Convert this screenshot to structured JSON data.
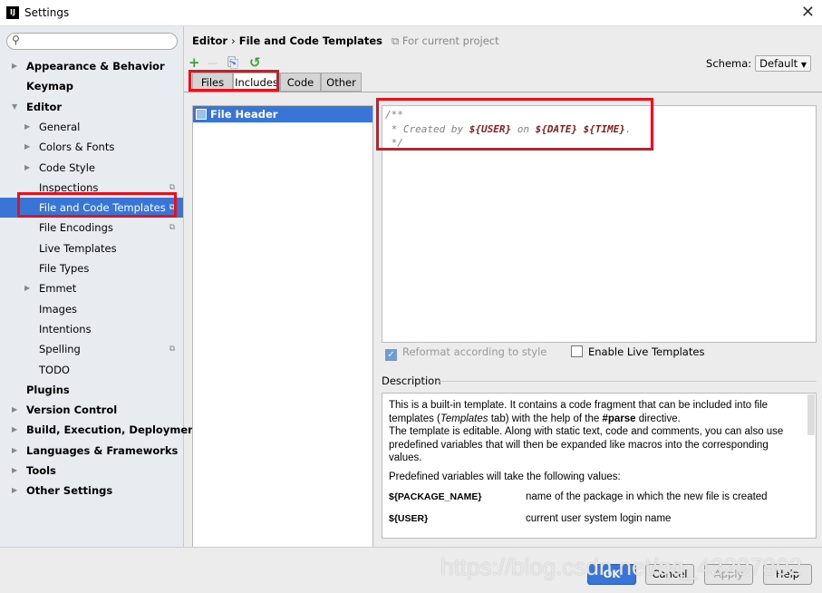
{
  "window": {
    "title": "Settings",
    "close": "✕",
    "logo": "IJ"
  },
  "search": {
    "placeholder": "",
    "icon": "search-icon"
  },
  "sidebar": {
    "items": [
      {
        "label": "Appearance & Behavior",
        "bold": true,
        "arrow": "▶",
        "level": 0
      },
      {
        "label": "Keymap",
        "bold": true,
        "level": 0
      },
      {
        "label": "Editor",
        "bold": true,
        "arrow": "▼",
        "level": 0
      },
      {
        "label": "General",
        "arrow": "▶",
        "level": 1
      },
      {
        "label": "Colors & Fonts",
        "arrow": "▶",
        "level": 1
      },
      {
        "label": "Code Style",
        "arrow": "▶",
        "level": 1
      },
      {
        "label": "Inspections",
        "level": 1,
        "project": true
      },
      {
        "label": "File and Code Templates",
        "level": 1,
        "project": true,
        "selected": true
      },
      {
        "label": "File Encodings",
        "level": 1,
        "project": true
      },
      {
        "label": "Live Templates",
        "level": 1
      },
      {
        "label": "File Types",
        "level": 1
      },
      {
        "label": "Emmet",
        "arrow": "▶",
        "level": 1
      },
      {
        "label": "Images",
        "level": 1
      },
      {
        "label": "Intentions",
        "level": 1
      },
      {
        "label": "Spelling",
        "level": 1,
        "project": true
      },
      {
        "label": "TODO",
        "level": 1
      },
      {
        "label": "Plugins",
        "bold": true,
        "level": 0
      },
      {
        "label": "Version Control",
        "bold": true,
        "arrow": "▶",
        "level": 0
      },
      {
        "label": "Build, Execution, Deployment",
        "bold": true,
        "arrow": "▶",
        "level": 0
      },
      {
        "label": "Languages & Frameworks",
        "bold": true,
        "arrow": "▶",
        "level": 0
      },
      {
        "label": "Tools",
        "bold": true,
        "arrow": "▶",
        "level": 0
      },
      {
        "label": "Other Settings",
        "bold": true,
        "arrow": "▶",
        "level": 0
      }
    ]
  },
  "breadcrumb": {
    "parent": "Editor",
    "sep": "›",
    "current": "File and Code Templates",
    "scope": "For current project"
  },
  "toolbar": {
    "add": "+",
    "remove": "—",
    "copy": "⎘",
    "reset": "↺"
  },
  "schema": {
    "label": "Schema:",
    "value": "Default"
  },
  "tabs": [
    "Files",
    "Includes",
    "Code",
    "Other"
  ],
  "active_tab": "Includes",
  "templates": [
    "File Header"
  ],
  "editor": {
    "line1": "/**",
    "line2_pre": " * Created by ",
    "var_user": "${USER}",
    "on": " on ",
    "var_date": "${DATE}",
    "space": " ",
    "var_time": "${TIME}",
    "dot": ".",
    "line3": " */"
  },
  "options": {
    "reformat": "Reformat according to style",
    "reformat_checked": true,
    "live": "Enable Live Templates",
    "live_checked": false
  },
  "description": {
    "label": "Description",
    "p1a": "This is a built-in template. It contains a code fragment that can be included into file templates (",
    "p1b": "Templates",
    "p1c": " tab) with the help of the ",
    "p1d": "#parse",
    "p1e": " directive.",
    "p2": "The template is editable. Along with static text, code and comments, you can also use predefined variables that will then be expanded like macros into the corresponding values.",
    "p3": "Predefined variables will take the following values:",
    "vars": [
      {
        "name": "${PACKAGE_NAME}",
        "desc": "name of the package in which the new file is created"
      },
      {
        "name": "${USER}",
        "desc": "current user system login name"
      }
    ]
  },
  "buttons": {
    "ok": "OK",
    "cancel": "Cancel",
    "apply": "Apply",
    "help": "Help"
  },
  "watermark": "https://blog.csdn.net/qq_43297802",
  "colors": {
    "accent": "#3875d7",
    "highlight": "#e8101c"
  }
}
